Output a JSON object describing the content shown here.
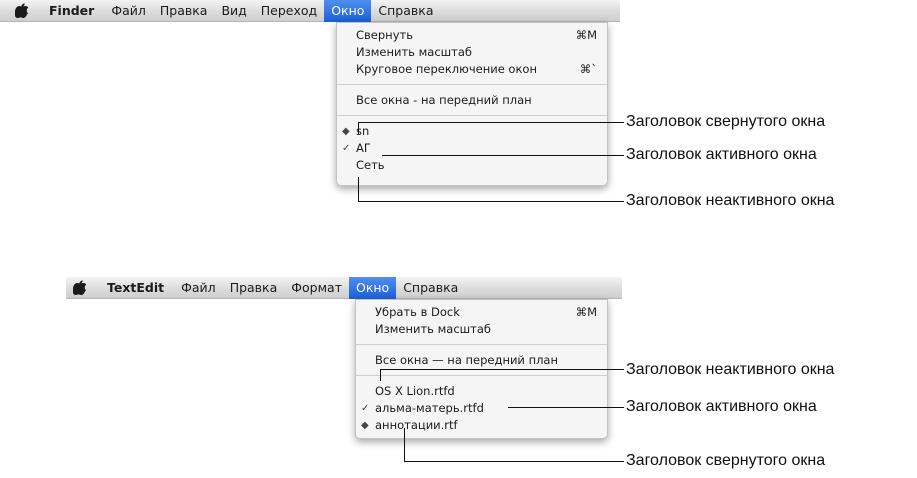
{
  "menubar1": {
    "app": "Finder",
    "items": [
      "Файл",
      "Правка",
      "Вид",
      "Переход",
      "Окно",
      "Справка"
    ]
  },
  "menu1": {
    "items": [
      {
        "label": "Свернуть",
        "shortcut": "⌘M"
      },
      {
        "label": "Изменить масштаб",
        "shortcut": ""
      },
      {
        "label": "Круговое переключение окон",
        "shortcut": "⌘`"
      },
      {
        "label": "Все окна - на передний план",
        "shortcut": ""
      },
      {
        "label": "sn",
        "mark": "◆"
      },
      {
        "label": "АГ",
        "mark": "✓"
      },
      {
        "label": "Сеть",
        "mark": ""
      }
    ]
  },
  "callouts1": {
    "minimized": "Заголовок свернутого окна",
    "active": "Заголовок активного окна",
    "inactive": "Заголовок неактивного окна"
  },
  "menubar2": {
    "app": "TextEdit",
    "items": [
      "Файл",
      "Правка",
      "Формат",
      "Окно",
      "Справка"
    ]
  },
  "menu2": {
    "items": [
      {
        "label": "Убрать в Dock",
        "shortcut": "⌘M"
      },
      {
        "label": "Изменить масштаб",
        "shortcut": ""
      },
      {
        "label": "Все окна — на передний план",
        "shortcut": ""
      },
      {
        "label": "OS X Lion.rtfd",
        "mark": ""
      },
      {
        "label": "альма-матерь.rtfd",
        "mark": "✓"
      },
      {
        "label": "аннотации.rtf",
        "mark": "◆"
      }
    ]
  },
  "callouts2": {
    "inactive": "Заголовок неактивного окна",
    "active": "Заголовок активного окна",
    "minimized": "Заголовок свернутого окна"
  }
}
